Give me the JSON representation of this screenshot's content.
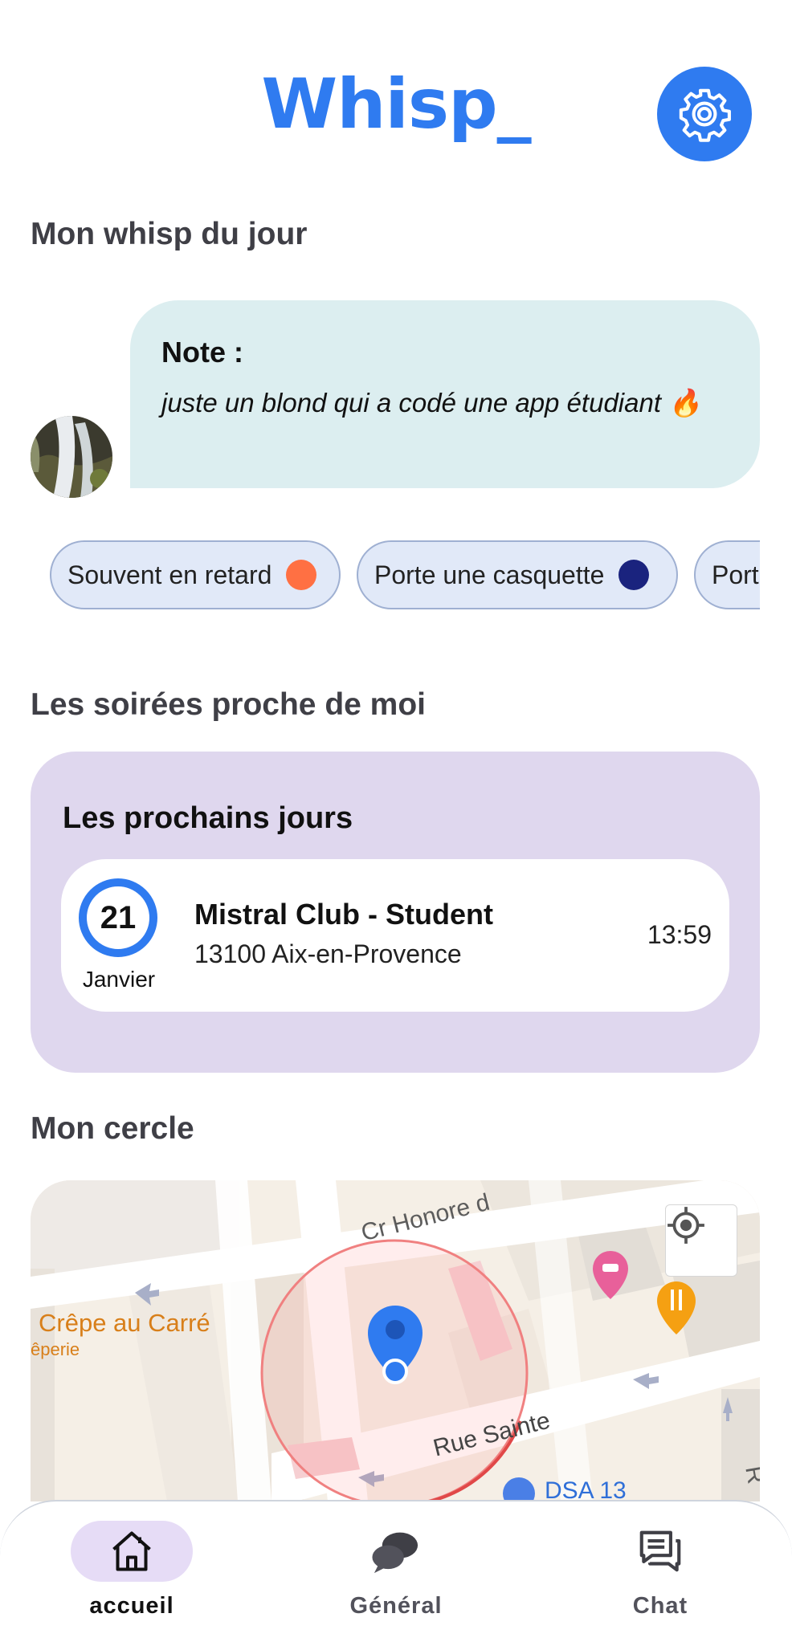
{
  "header": {
    "logo": "Whisp_",
    "settings_icon": "gear-icon"
  },
  "colors": {
    "accent": "#2f7bf0",
    "bubble": "#dceef0",
    "events_card": "#dfd7ee",
    "chip_bg": "#e1e9f8",
    "nav_active": "#e6dcf6"
  },
  "whisp": {
    "section_title": "Mon whisp du jour",
    "note_label": "Note :",
    "note_text": "juste un blond qui a codé une app étudiant 🔥"
  },
  "traits": [
    {
      "label": "Souvent en retard",
      "dot_color": "#ff7043"
    },
    {
      "label": "Porte une casquette",
      "dot_color": "#1a237e"
    },
    {
      "label": "Port",
      "dot_color": ""
    }
  ],
  "events": {
    "section_title": "Les soirées proche de moi",
    "card_title": "Les prochains jours",
    "items": [
      {
        "day": "21",
        "month": "Janvier",
        "name": "Mistral Club - Student",
        "address": "13100 Aix-en-Provence",
        "time": "13:59"
      }
    ]
  },
  "circle": {
    "section_title": "Mon cercle",
    "map": {
      "street_1": "Cr Honore d",
      "street_2": "Rue Sainte",
      "place_1": "Crêpe au Carré",
      "place_1_sub": "êperie",
      "place_2": "DSA 13",
      "edge_letter": "R",
      "locate_icon": "crosshair-icon"
    }
  },
  "nav": {
    "items": [
      {
        "label": "accueil",
        "icon": "home-icon",
        "active": true
      },
      {
        "label": "Général",
        "icon": "chat-bubbles-icon",
        "active": false
      },
      {
        "label": "Chat",
        "icon": "message-icon",
        "active": false
      }
    ]
  }
}
